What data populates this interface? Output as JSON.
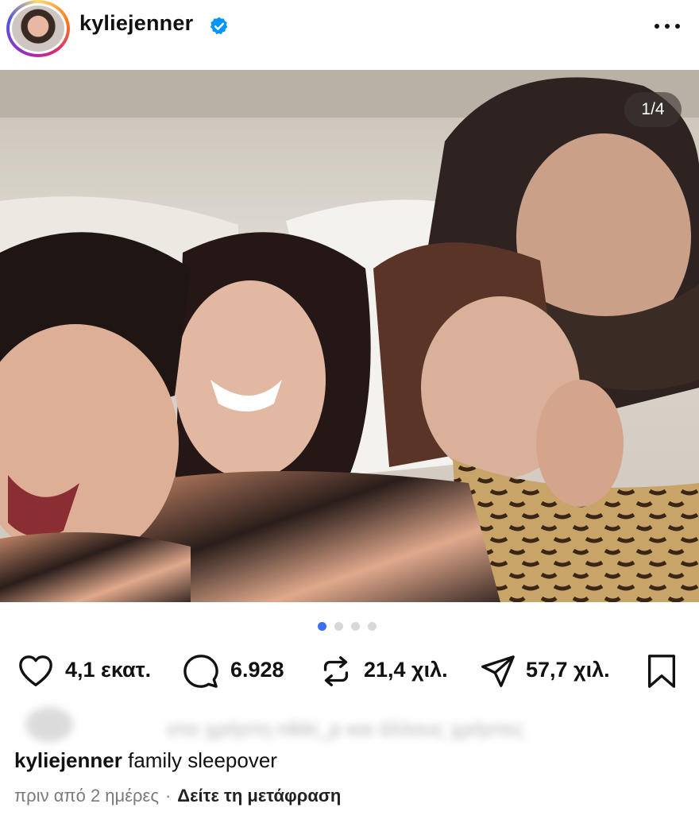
{
  "post": {
    "username": "kyliejenner",
    "verified": true,
    "avatar_icon": "profile-avatar",
    "more_icon": "more-dots-icon",
    "image": {
      "description": "group-selfie-photo",
      "page_indicator": "1/4",
      "total_slides": 4,
      "active_slide": 1
    },
    "actions": {
      "likes": "4,1 εκατ.",
      "comments": "6.928",
      "reposts": "21,4 χιλ.",
      "shares": "57,7 χιλ."
    },
    "liked_by_text": "στο χρήστη nikki_p και άλλους χρήστες",
    "caption": {
      "username": "kyliejenner",
      "text": "family sleepover"
    },
    "meta": {
      "time": "πριν από 2 ημέρες",
      "separator": "·",
      "translate": "Δείτε τη μετάφραση"
    }
  },
  "colors": {
    "accent_blue": "#3b6cf2",
    "verified_blue": "#0095f6",
    "text_primary": "#111111",
    "text_secondary": "#7a7a7a"
  }
}
